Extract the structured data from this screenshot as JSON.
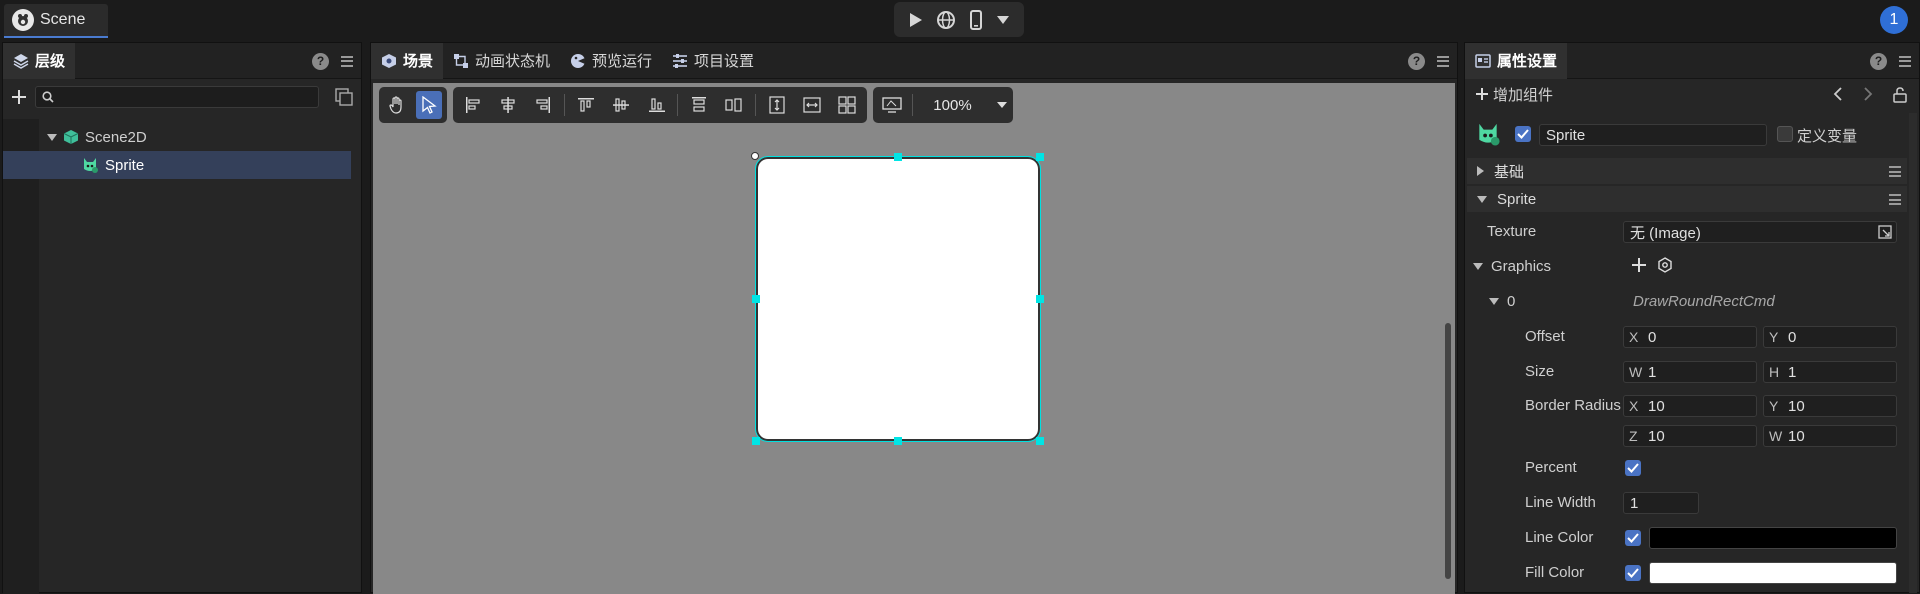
{
  "topbar": {
    "scene_tab": "Scene",
    "notification_count": "1"
  },
  "hierarchy": {
    "tab_label": "层级",
    "tree": [
      {
        "label": "Scene2D",
        "icon": "cube-icon"
      },
      {
        "label": "Sprite",
        "icon": "sprite-icon"
      }
    ]
  },
  "scene_panel": {
    "tabs": [
      "场景",
      "动画状态机",
      "预览运行",
      "项目设置"
    ],
    "zoom": "100%"
  },
  "props": {
    "tab_label": "属性设置",
    "add_component": "增加组件",
    "node_name": "Sprite",
    "define_var": "定义变量",
    "section_basic": "基础",
    "section_sprite": "Sprite",
    "texture_label": "Texture",
    "texture_value": "无 (Image)",
    "graphics_label": "Graphics",
    "cmd_index": "0",
    "cmd_type": "DrawRoundRectCmd",
    "offset_label": "Offset",
    "offset_x": "0",
    "offset_y": "0",
    "size_label": "Size",
    "size_w": "1",
    "size_h": "1",
    "radius_label": "Border Radius",
    "radius_x": "10",
    "radius_y": "10",
    "radius_z": "10",
    "radius_w": "10",
    "percent_label": "Percent",
    "line_width_label": "Line Width",
    "line_width": "1",
    "line_color_label": "Line Color",
    "line_color": "#000000",
    "fill_color_label": "Fill Color",
    "fill_color": "#ffffff",
    "axis": {
      "x": "X",
      "y": "Y",
      "w": "W",
      "h": "H",
      "z": "Z"
    }
  }
}
